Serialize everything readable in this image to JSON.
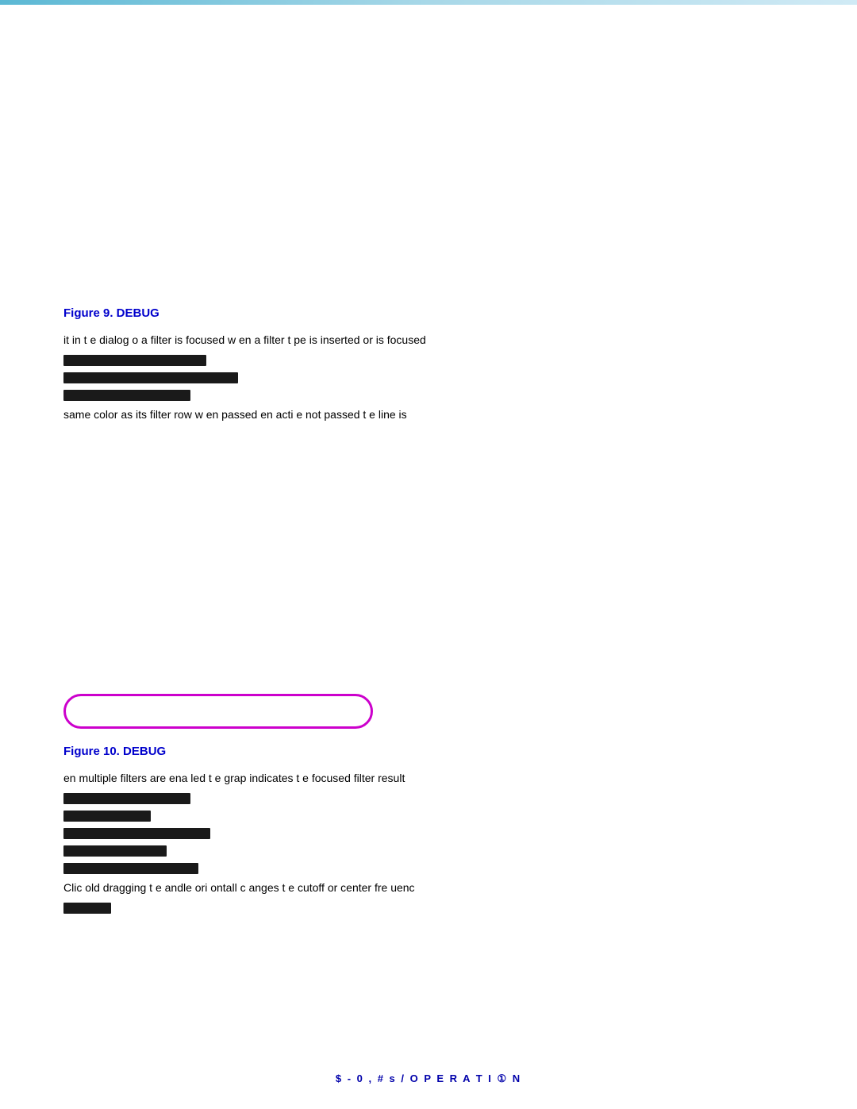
{
  "top_bar": {
    "color_start": "#5bb8d4",
    "color_end": "#d0eaf5"
  },
  "figure9": {
    "label": "Figure 9.  DEBUG",
    "line1": "it  in t  e dialog  o    a filter is focused w  en a filter t  pe is inserted    or is focused",
    "redacted1": "##########3",
    "redacted2": "##########TH6",
    "redacted3": "#########6",
    "line4": "same color as its filter row w  en     passed      en acti  e  not    passed    t  e line is"
  },
  "figure10": {
    "label": "Figure 10.  DEBUG",
    "line1": "  en multiple filters are ena  led  t  e grap   indicates t  e focused filter result",
    "redacted1": "#########3",
    "redacted2": "TH####3",
    "redacted3": "A##########3",
    "redacted4": "#########h",
    "redacted5": "B###########3",
    "line6": "Clic    old  dragging t  e  andle  ori  ontall   c  anges t  e cutoff or center fre  uenc",
    "redacted6": "####"
  },
  "footer": {
    "text": "$ - 0   , # s  / O P E R A T I ① N"
  },
  "pill": {
    "border_color": "#cc00cc"
  }
}
